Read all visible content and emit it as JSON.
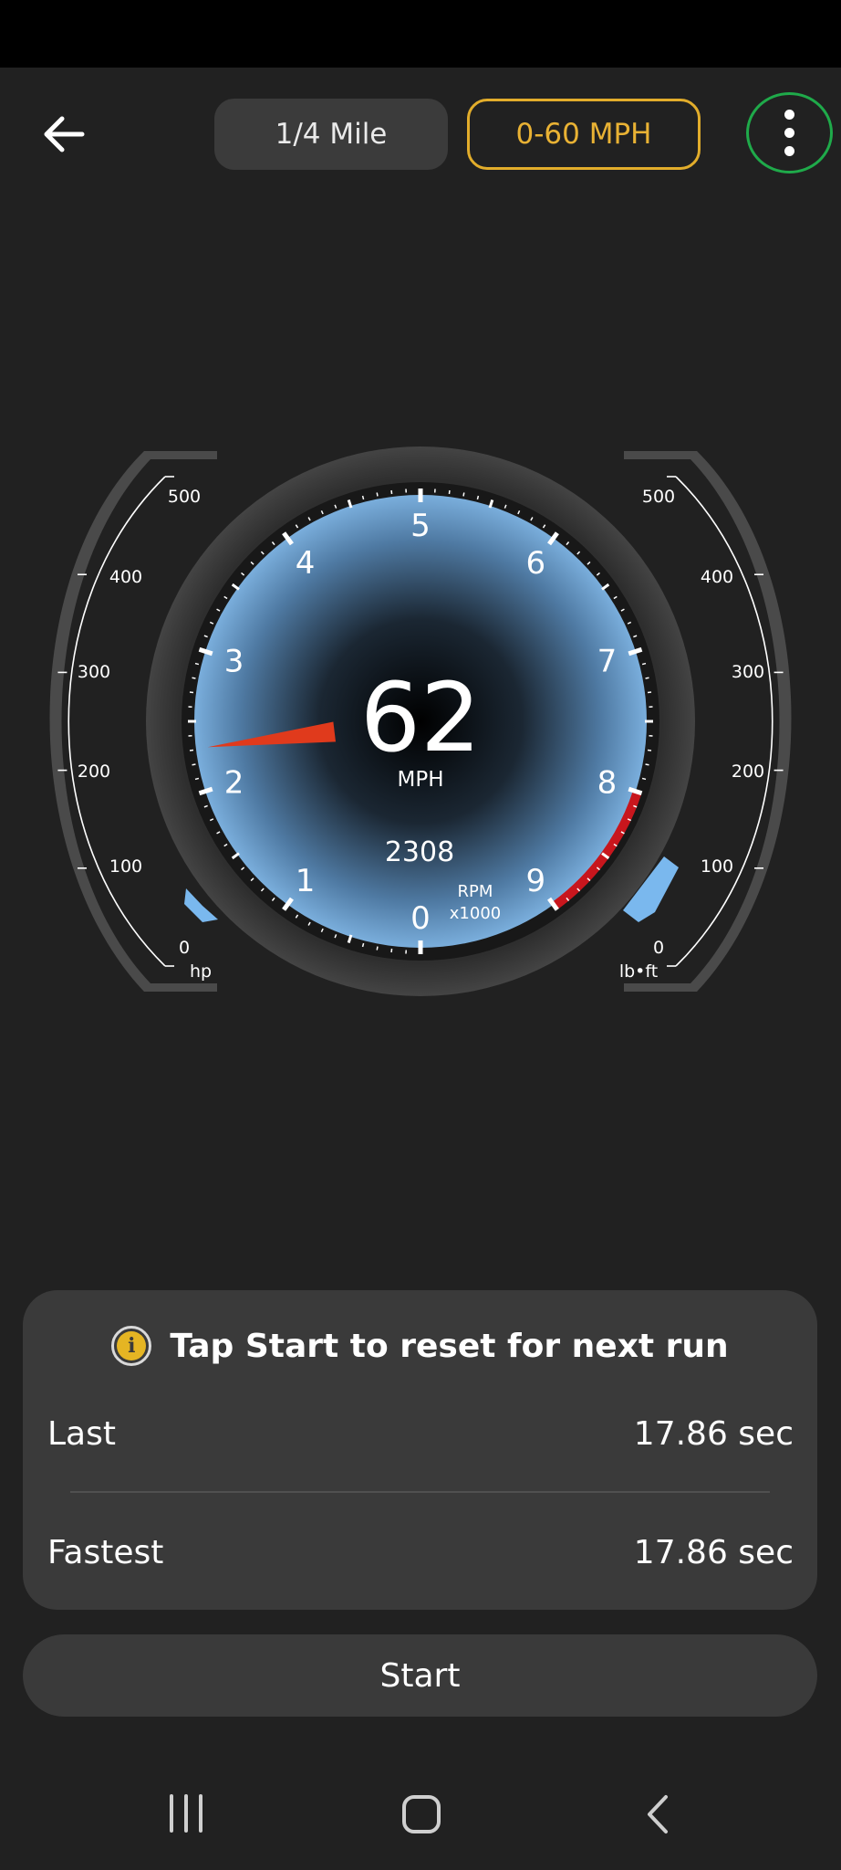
{
  "header": {
    "back_icon": "arrow-left-icon",
    "tabs": [
      {
        "label": "1/4 Mile",
        "selected": false
      },
      {
        "label": "0-60 MPH",
        "selected": true
      }
    ],
    "menu_icon": "more-vertical-icon",
    "accent_color": "#e9b234",
    "menu_ring_color": "#1faa4a"
  },
  "gauge": {
    "speed": "62",
    "speed_unit": "MPH",
    "rpm_value": "2308",
    "rpm_unit": "RPM",
    "rpm_scale": "x1000",
    "rpm_dial_labels": [
      "0",
      "1",
      "2",
      "3",
      "4",
      "5",
      "6",
      "7",
      "8",
      "9"
    ],
    "needle_rpm": 2.308,
    "redline_start_rpm": 8,
    "hp_labels": [
      "0",
      "100",
      "200",
      "300",
      "400",
      "500"
    ],
    "hp_unit": "hp",
    "hp_level": 0.05,
    "torque_labels": [
      "0",
      "100",
      "200",
      "300",
      "400",
      "500"
    ],
    "torque_unit": "lb•ft",
    "torque_level": 0.23,
    "accent_blue": "#7ab8ee",
    "redline_color": "#c8161d"
  },
  "results": {
    "info_icon": "info-icon",
    "message": "Tap Start to reset for next run",
    "last_label": "Last",
    "last_value": "17.86 sec",
    "fastest_label": "Fastest",
    "fastest_value": "17.86 sec"
  },
  "start_label": "Start",
  "navbar": {
    "recents_icon": "recents-icon",
    "home_icon": "home-icon",
    "back_icon": "nav-back-icon"
  }
}
